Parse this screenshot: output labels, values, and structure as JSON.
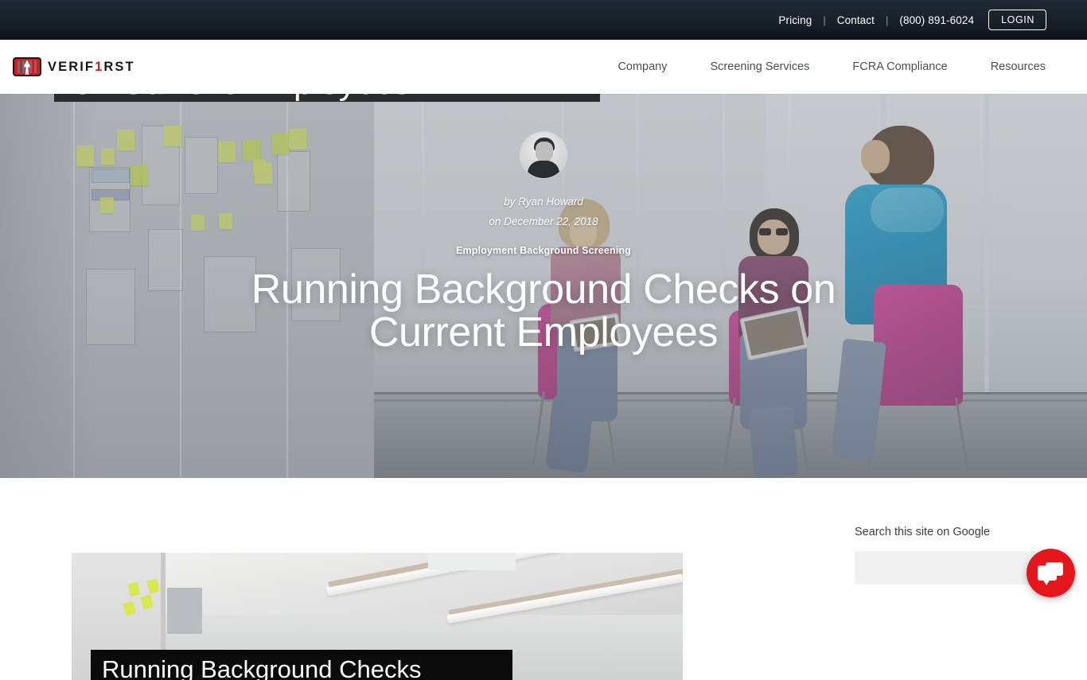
{
  "topbar": {
    "links": [
      {
        "label": "Pricing"
      },
      {
        "label": "Contact"
      },
      {
        "label": "(800) 891-6024"
      }
    ],
    "separator": "|",
    "login_label": "LOGIN",
    "background_color": "#18212a"
  },
  "header": {
    "logo": {
      "text_left": "VERIF",
      "text_one": "1",
      "text_right": "RST",
      "mark_color": "#d71920"
    },
    "nav": [
      {
        "label": "Company"
      },
      {
        "label": "Screening Services"
      },
      {
        "label": "FCRA Compliance"
      },
      {
        "label": "Resources"
      }
    ]
  },
  "hero": {
    "peek_caption": "on Current Employees",
    "author": "by Ryan Howard",
    "date": "on December 22, 2018",
    "category": "Employment Background Screening",
    "title": "Running Background Checks on Current Employees"
  },
  "post_card": {
    "caption": "Running Background Checks"
  },
  "sidebar": {
    "search_label": "Search this site on Google",
    "search_value": "",
    "search_placeholder": ""
  },
  "chat": {
    "icon": "chat-bubble-icon",
    "color": "#e5161c"
  }
}
